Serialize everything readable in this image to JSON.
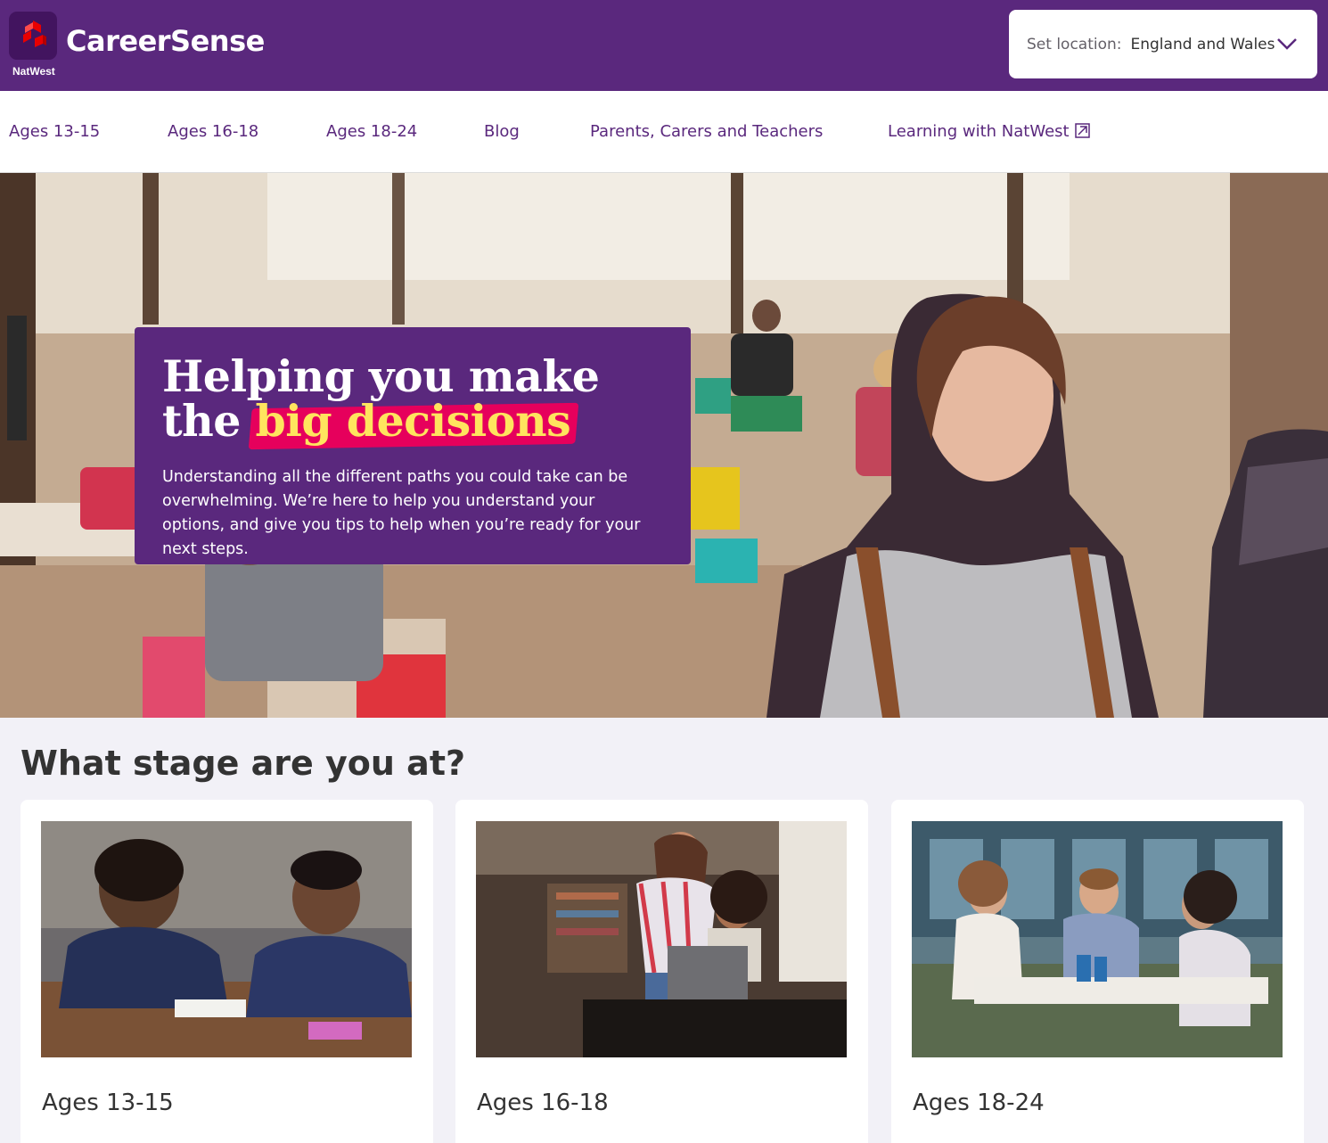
{
  "header": {
    "brand": "CareerSense",
    "logo_text": "NatWest",
    "location": {
      "label": "Set location:",
      "value": "England and Wales"
    }
  },
  "nav": {
    "items": [
      {
        "label": "Ages 13-15"
      },
      {
        "label": "Ages 16-18"
      },
      {
        "label": "Ages 18-24"
      },
      {
        "label": "Blog"
      },
      {
        "label": "Parents, Carers and Teachers"
      },
      {
        "label": "Learning with NatWest"
      }
    ]
  },
  "hero": {
    "title_part1": "Helping you make",
    "title_part2": "the",
    "title_highlight": "big decisions",
    "body": "Understanding all the different paths you could take can be overwhelming. We’re here to help you understand your options, and give you tips to help when you’re ready for your next steps."
  },
  "stages": {
    "heading": "What stage are you at?",
    "cards": [
      {
        "title": "Ages 13-15"
      },
      {
        "title": "Ages 16-18"
      },
      {
        "title": "Ages 18-24"
      }
    ]
  },
  "colors": {
    "brand_purple": "#5a287d",
    "dark_purple": "#42145f",
    "highlight_pink": "#e6005c",
    "highlight_yellow": "#ffe45e",
    "page_bg": "#f2f1f7"
  }
}
